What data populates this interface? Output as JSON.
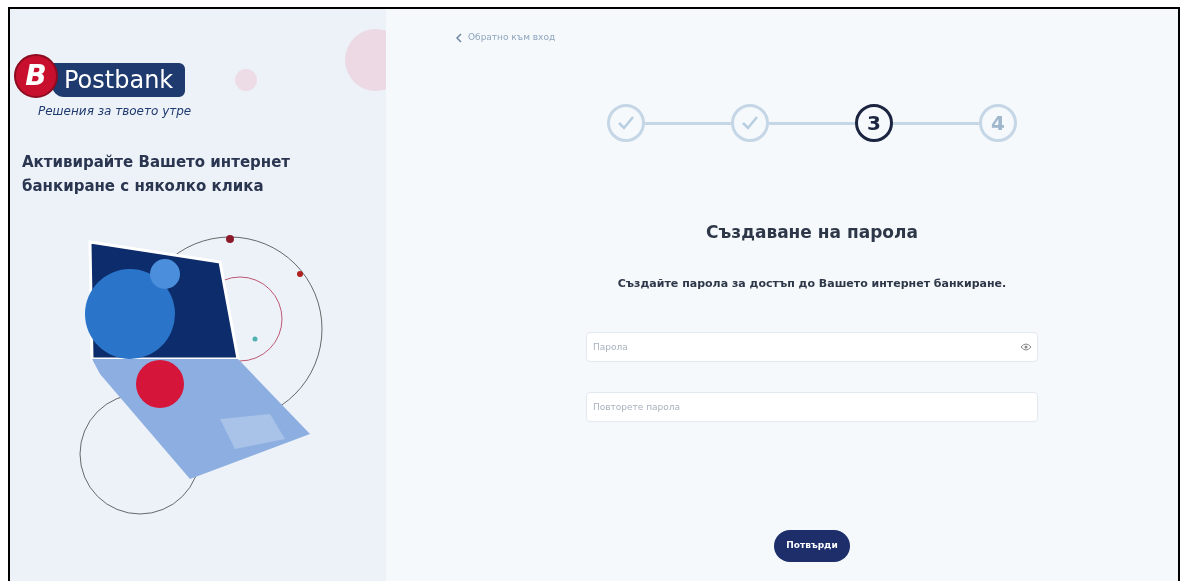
{
  "brand": {
    "logo_mark": "B",
    "name": "Postbank",
    "tagline": "Решения за твоето утре"
  },
  "promo": {
    "headline": "Активирайте Вашето интернет банкиране с няколко клика"
  },
  "back_link": {
    "label": "Обратно към вход"
  },
  "steps": [
    {
      "done": true,
      "current": false
    },
    {
      "done": true,
      "current": false
    },
    {
      "done": false,
      "current": true,
      "label": "3"
    },
    {
      "done": false,
      "current": false,
      "label": "4"
    }
  ],
  "form": {
    "title": "Създаване на парола",
    "subtitle": "Създайте парола за достъп до Вашето интернет банкиране.",
    "fields": [
      {
        "placeholder": "Парола",
        "reveal": true
      },
      {
        "placeholder": "Повторете парола",
        "reveal": false
      }
    ],
    "submit": "Потвърди"
  }
}
